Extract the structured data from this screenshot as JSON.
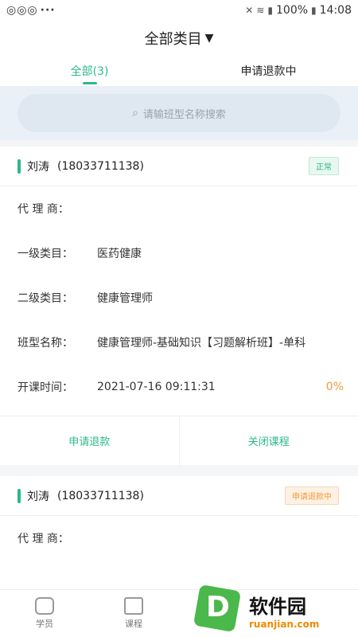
{
  "status_bar": {
    "left_dots": "···",
    "battery": "100%",
    "time": "14:08",
    "icons": [
      "mute-icon",
      "wifi-icon",
      "signal-icon",
      "battery-icon"
    ]
  },
  "header": {
    "title": "全部类目",
    "caret": "▼"
  },
  "tabs": [
    {
      "label": "全部(3)",
      "active": true
    },
    {
      "label": "申请退款中",
      "active": false
    }
  ],
  "search": {
    "placeholder": "请输班型名称搜索"
  },
  "labels": {
    "agent": "代 理 商：",
    "category1": "一级类目：",
    "category2": "二级类目：",
    "class_name": "班型名称：",
    "start_time": "开课时间："
  },
  "cards": [
    {
      "name": "刘涛",
      "phone": "(18033711138)",
      "status": "正常",
      "agent": "",
      "category1": "医药健康",
      "category2": "健康管理师",
      "class_name": "健康管理师-基础知识【习题解析班】-单科",
      "start_time": "2021-07-16 09:11:31",
      "progress": "0%",
      "actions": [
        "申请退款",
        "关闭课程"
      ]
    },
    {
      "name": "刘涛",
      "phone": "(18033711138)",
      "status": "申请退款中",
      "agent": ""
    }
  ],
  "bottom_nav": [
    {
      "label": "学员",
      "icon": "student-icon"
    },
    {
      "label": "课程",
      "icon": "course-icon"
    }
  ],
  "watermark": {
    "logo_letter": "D",
    "cn": "软件园",
    "en": "ruanjian.com"
  },
  "colors": {
    "accent": "#2cb888",
    "warning": "#f39a3d",
    "search_bg": "#e9f0f8"
  }
}
